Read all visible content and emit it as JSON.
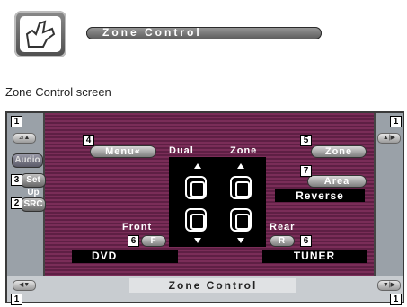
{
  "header": {
    "title": "Zone Control"
  },
  "caption": "Zone Control screen",
  "screen": {
    "menu_button": "Menu«",
    "dual_label": "Dual",
    "zone_label": "Zone",
    "zone_button": "Zone",
    "area_button": "Area",
    "reverse_label": "Reverse",
    "front_label": "Front",
    "rear_label": "Rear",
    "front_button": "F",
    "rear_button": "R",
    "front_source": "DVD",
    "rear_source": "TUNER",
    "bottom_title": "Zone Control",
    "side_audio": "Audio",
    "side_setup": "Set Up",
    "side_src": "SRC",
    "corner_tl": "⊿▲",
    "corner_tr": "▲|▶",
    "corner_bl": "◀▼",
    "corner_br": "▼|▶"
  },
  "callouts": [
    "1",
    "1",
    "1",
    "1",
    "2",
    "3",
    "4",
    "5",
    "6",
    "6",
    "7"
  ]
}
